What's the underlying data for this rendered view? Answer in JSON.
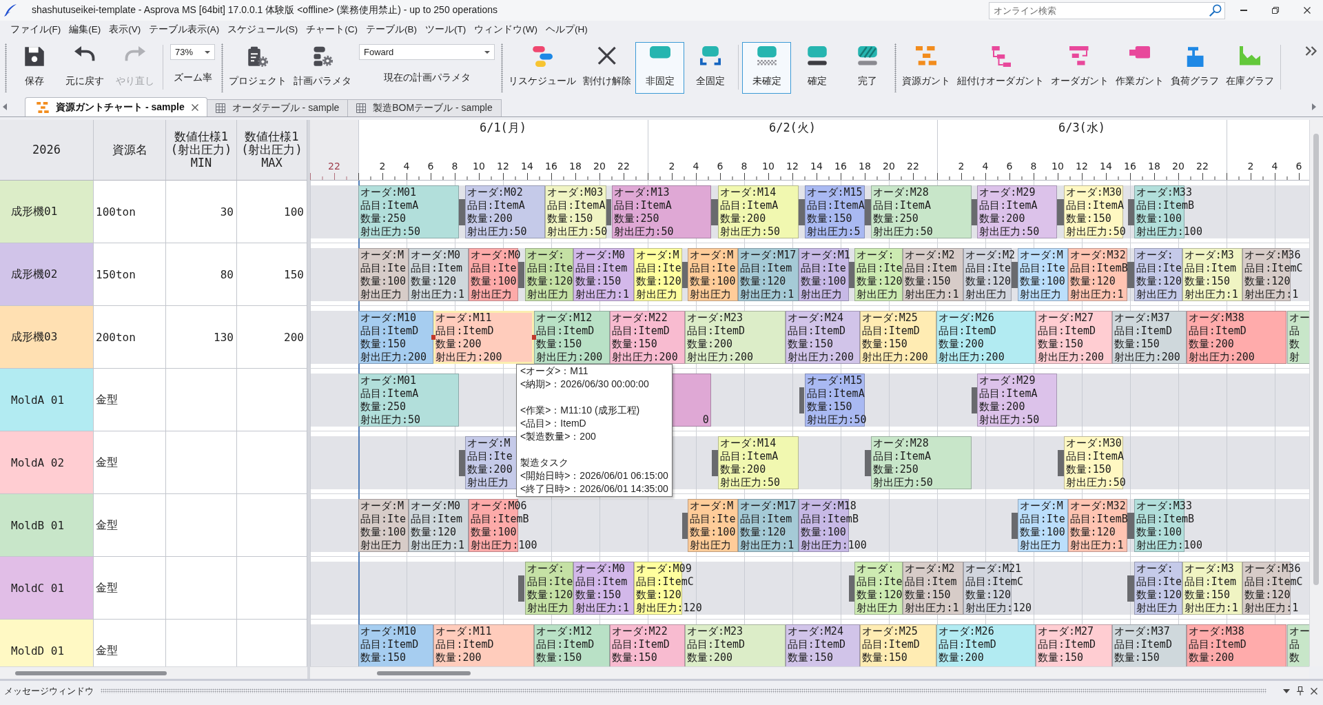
{
  "window": {
    "title": "shashutuseikei-template - Asprova MS [64bit] 17.0.0.1 体験版 <offline> (業務使用禁止) - up to 250 operations",
    "search": {
      "placeholder": "オンライン検索"
    }
  },
  "menu": [
    "ファイル(F)",
    "編集(E)",
    "表示(V)",
    "テーブル表示(A)",
    "スケジュール(S)",
    "チャート(C)",
    "テーブル(B)",
    "ツール(T)",
    "ウィンドウ(W)",
    "ヘルプ(H)"
  ],
  "toolbar": {
    "groups": [
      {
        "items": [
          {
            "kind": "button",
            "label": "保存",
            "selected": false,
            "disabled": false
          },
          {
            "kind": "button",
            "label": "元に戻す",
            "selected": false,
            "disabled": false
          },
          {
            "kind": "button",
            "label": "やり直し",
            "selected": false,
            "disabled": true
          },
          {
            "kind": "separator"
          },
          {
            "kind": "dropdown",
            "value": "73%",
            "caption": "ズーム率"
          }
        ]
      },
      {
        "items": [
          {
            "kind": "button",
            "label": "プロジェクト",
            "selected": false,
            "disabled": false
          },
          {
            "kind": "button",
            "label": "計画パラメタ",
            "selected": false,
            "disabled": false
          },
          {
            "kind": "dropdown",
            "value": "Foward",
            "caption": "現在の計画パラメタ"
          }
        ]
      },
      {
        "items": [
          {
            "kind": "button",
            "label": "リスケジュール",
            "selected": false,
            "disabled": false
          },
          {
            "kind": "button",
            "label": "割付け解除",
            "selected": false,
            "disabled": false
          },
          {
            "kind": "button",
            "label": "非固定",
            "selected": true,
            "disabled": false
          },
          {
            "kind": "button",
            "label": "全固定",
            "selected": false,
            "disabled": false
          },
          {
            "kind": "separator"
          },
          {
            "kind": "button",
            "label": "未確定",
            "selected": true,
            "disabled": false
          },
          {
            "kind": "button",
            "label": "確定",
            "selected": false,
            "disabled": false
          },
          {
            "kind": "button",
            "label": "完了",
            "selected": false,
            "disabled": false
          }
        ]
      },
      {
        "items": [
          {
            "kind": "button",
            "label": "資源ガント",
            "selected": false,
            "disabled": false
          },
          {
            "kind": "button",
            "label": "紐付けオーダガント",
            "selected": false,
            "disabled": false
          },
          {
            "kind": "button",
            "label": "オーダガント",
            "selected": false,
            "disabled": false
          },
          {
            "kind": "button",
            "label": "作業ガント",
            "selected": false,
            "disabled": false
          },
          {
            "kind": "button",
            "label": "負荷グラフ",
            "selected": false,
            "disabled": false
          },
          {
            "kind": "button",
            "label": "在庫グラフ",
            "selected": false,
            "disabled": false
          },
          {
            "kind": "separator"
          }
        ]
      }
    ]
  },
  "tabs": [
    {
      "label": "資源ガントチャート - sample",
      "selected": true
    },
    {
      "label": "オーダテーブル - sample",
      "selected": false
    },
    {
      "label": "製造BOMテーブル - sample",
      "selected": false
    }
  ],
  "table": {
    "columns": [
      "2026",
      "資源名",
      "数値仕様1\n(射出圧力)\nMIN",
      "数値仕様1\n(射出圧力)\nMAX"
    ]
  },
  "gantt": {
    "days": [
      {
        "holiday": true,
        "hours": [
          "22"
        ]
      },
      {
        "label": "6/1(月)",
        "holiday": false,
        "hours": [
          "2",
          "4",
          "6",
          "8",
          "10",
          "12",
          "14",
          "16",
          "18",
          "20",
          "22"
        ]
      },
      {
        "label": "6/2(火)",
        "holiday": false,
        "hours": [
          "2",
          "4",
          "6",
          "8",
          "10",
          "12",
          "14",
          "16",
          "18",
          "20",
          "22"
        ]
      },
      {
        "label": "6/3(水)",
        "holiday": false,
        "hours": [
          "2",
          "4",
          "6",
          "8",
          "10",
          "12",
          "14",
          "16",
          "18",
          "20",
          "22"
        ]
      },
      {
        "holiday": false,
        "hours": [
          "2",
          "4",
          "6"
        ]
      }
    ]
  },
  "resources": [
    {
      "name": "成形機01",
      "resource_name": "100ton",
      "min": "30",
      "max": "100",
      "color": "#dcedc8",
      "items": [
        {
          "kind": "task",
          "color": "#b2dfdb",
          "selected": false,
          "lines": [
            "オーダ:M01",
            "品目:ItemA",
            "数量:250",
            "射出圧力:50"
          ]
        },
        {
          "kind": "setup"
        },
        {
          "kind": "task",
          "color": "#c5cae9",
          "selected": false,
          "lines": [
            "オーダ:M02",
            "品目:ItemA",
            "数量:200",
            "射出圧力:50"
          ]
        },
        {
          "kind": "task",
          "color": "#f0f4c3",
          "selected": false,
          "lines": [
            "オーダ:M03",
            "品目:ItemA",
            "数量:150",
            "射出圧力:50"
          ]
        },
        {
          "kind": "setup"
        },
        {
          "kind": "task",
          "color": "#dfa8d5",
          "selected": false,
          "lines": [
            "オーダ:M13",
            "品目:ItemA",
            "数量:250",
            "射出圧力:50"
          ]
        },
        {
          "kind": "setup"
        },
        {
          "kind": "task",
          "color": "#f1f8b0",
          "selected": false,
          "lines": [
            "オーダ:M14",
            "品目:ItemA",
            "数量:200",
            "射出圧力:50"
          ]
        },
        {
          "kind": "setup"
        },
        {
          "kind": "task",
          "color": "#a9b9f2",
          "selected": false,
          "lines": [
            "オーダ:M15",
            "品目:ItemA",
            "数量:150",
            "射出圧力:5"
          ]
        },
        {
          "kind": "setup"
        },
        {
          "kind": "task",
          "color": "#c8e6c9",
          "selected": false,
          "lines": [
            "オーダ:M28",
            "品目:ItemA",
            "数量:250",
            "射出圧力:50"
          ]
        },
        {
          "kind": "setup"
        },
        {
          "kind": "task",
          "color": "#dcc2ea",
          "selected": false,
          "lines": [
            "オーダ:M29",
            "品目:ItemA",
            "数量:200",
            "射出圧力:50"
          ]
        },
        {
          "kind": "setup"
        },
        {
          "kind": "task",
          "color": "#fff8c2",
          "selected": false,
          "lines": [
            "オーダ:M30",
            "品目:ItemA",
            "数量:150",
            "射出圧力:50"
          ]
        },
        {
          "kind": "setup"
        },
        {
          "kind": "task",
          "color": "#b2dfdb",
          "selected": false,
          "lines": [
            "オーダ:M33",
            "品目:ItemB",
            "数量:100",
            "射出圧力:100"
          ]
        }
      ]
    },
    {
      "name": "成形機02",
      "resource_name": "150ton",
      "min": "80",
      "max": "150",
      "color": "#d1c4e9",
      "items": [
        {
          "kind": "task",
          "color": "#d7ccc8",
          "selected": false,
          "lines": [
            "オーダ:M",
            "品目:Ite",
            "数量:100",
            "射出圧力"
          ]
        },
        {
          "kind": "task",
          "color": "#cfd8dc",
          "selected": false,
          "lines": [
            "オーダ:M0",
            "品目:Item",
            "数量:120",
            "射出圧力:1"
          ]
        },
        {
          "kind": "task",
          "color": "#fdaaa9",
          "selected": false,
          "lines": [
            "オーダ:M0",
            "品目:Ite",
            "数量:100",
            "射出圧力"
          ]
        },
        {
          "kind": "setup"
        },
        {
          "kind": "task",
          "color": "#c5e1a5",
          "selected": false,
          "lines": [
            "オーダ:",
            "品目:Ite",
            "数量:120",
            "射出圧力"
          ]
        },
        {
          "kind": "task",
          "color": "#d3b8ea",
          "selected": false,
          "lines": [
            "オーダ:M0",
            "品目:Item",
            "数量:150",
            "射出圧力:1"
          ]
        },
        {
          "kind": "task",
          "color": "#ffff9e",
          "selected": false,
          "lines": [
            "オーダ:M",
            "品目:Ite",
            "数量:120",
            "射出圧力"
          ]
        },
        {
          "kind": "setup"
        },
        {
          "kind": "task",
          "color": "#ffcc99",
          "selected": false,
          "lines": [
            "オーダ:M",
            "品目:Ite",
            "数量:100",
            "射出圧力"
          ]
        },
        {
          "kind": "task",
          "color": "#a5cad6",
          "selected": false,
          "lines": [
            "オーダ:M17",
            "品目:Item",
            "数量:120",
            "射出圧力:1"
          ]
        },
        {
          "kind": "task",
          "color": "#c7b9e6",
          "selected": false,
          "lines": [
            "オーダ:M1",
            "品目:Ite",
            "数量:100",
            "射出圧力"
          ]
        },
        {
          "kind": "setup"
        },
        {
          "kind": "task",
          "color": "#cdebb2",
          "selected": false,
          "lines": [
            "オーダ:",
            "品目:Ite",
            "数量:120",
            "射出圧力"
          ]
        },
        {
          "kind": "task",
          "color": "#d7ccc8",
          "selected": false,
          "lines": [
            "オーダ:M2",
            "品目:Item",
            "数量:150",
            "射出圧力:1"
          ]
        },
        {
          "kind": "task",
          "color": "#d1d5de",
          "selected": false,
          "lines": [
            "オーダ:M2",
            "品目:Ite",
            "数量:120",
            "射出圧力"
          ]
        },
        {
          "kind": "setup"
        },
        {
          "kind": "task",
          "color": "#bbdefb",
          "selected": false,
          "lines": [
            "オーダ:M",
            "品目:Ite",
            "数量:100",
            "射出圧力"
          ]
        },
        {
          "kind": "task",
          "color": "#ffc4b2",
          "selected": false,
          "lines": [
            "オーダ:M32",
            "品目:ItemB",
            "数量:120",
            "射出圧力:1"
          ]
        },
        {
          "kind": "setup"
        },
        {
          "kind": "task",
          "color": "#c5cae9",
          "selected": false,
          "lines": [
            "オーダ:",
            "品目:Ite",
            "数量:120",
            "射出圧力"
          ]
        },
        {
          "kind": "task",
          "color": "#f0f4c3",
          "selected": false,
          "lines": [
            "オーダ:M3",
            "品目:Item",
            "数量:150",
            "射出圧力:1"
          ]
        },
        {
          "kind": "task",
          "color": "#d7ccc8",
          "selected": false,
          "lines": [
            "オーダ:M36",
            "品目:ItemC",
            "数量:120",
            "射出圧力:1"
          ]
        }
      ]
    },
    {
      "name": "成形機03",
      "resource_name": "200ton",
      "min": "130",
      "max": "200",
      "color": "#ffe0b2",
      "items": [
        {
          "kind": "task",
          "color": "#a6cdf0",
          "selected": false,
          "lines": [
            "オーダ:M10",
            "品目:ItemD",
            "数量:150",
            "射出圧力:200"
          ]
        },
        {
          "kind": "task",
          "color": "#ffccbc",
          "selected": true,
          "lines": [
            "オーダ:M11",
            "品目:ItemD",
            "数量:200",
            "射出圧力:200"
          ]
        },
        {
          "kind": "task",
          "color": "#b9e1c6",
          "selected": false,
          "lines": [
            "オーダ:M12",
            "品目:ItemD",
            "数量:150",
            "射出圧力:200"
          ]
        },
        {
          "kind": "task",
          "color": "#f8bbd0",
          "selected": false,
          "lines": [
            "オーダ:M22",
            "品目:ItemD",
            "数量:150",
            "射出圧力:200"
          ]
        },
        {
          "kind": "task",
          "color": "#dcedc8",
          "selected": false,
          "lines": [
            "オーダ:M23",
            "品目:ItemD",
            "数量:200",
            "射出圧力:200"
          ]
        },
        {
          "kind": "task",
          "color": "#d1c4e9",
          "selected": false,
          "lines": [
            "オーダ:M24",
            "品目:ItemD",
            "数量:150",
            "射出圧力:200"
          ]
        },
        {
          "kind": "task",
          "color": "#ffecb3",
          "selected": false,
          "lines": [
            "オーダ:M25",
            "品目:ItemD",
            "数量:150",
            "射出圧力:200"
          ]
        },
        {
          "kind": "task",
          "color": "#b2ebf2",
          "selected": false,
          "lines": [
            "オーダ:M26",
            "品目:ItemD",
            "数量:200",
            "射出圧力:200"
          ]
        },
        {
          "kind": "task",
          "color": "#ffcdd2",
          "selected": false,
          "lines": [
            "オーダ:M27",
            "品目:ItemD",
            "数量:150",
            "射出圧力:200"
          ]
        },
        {
          "kind": "task",
          "color": "#cfd8dc",
          "selected": false,
          "lines": [
            "オーダ:M37",
            "品目:ItemD",
            "数量:150",
            "射出圧力:200"
          ]
        },
        {
          "kind": "task",
          "color": "#ffabab",
          "selected": false,
          "lines": [
            "オーダ:M38",
            "品目:ItemD",
            "数量:200",
            "射出圧力:200"
          ]
        },
        {
          "kind": "task",
          "color": "#c8e6c9",
          "selected": false,
          "lines": [
            "オー",
            "品",
            "数",
            "射"
          ]
        }
      ]
    },
    {
      "name": "MoldA 01",
      "resource_name": "金型",
      "color": "#b2ebf2",
      "items": [
        {
          "kind": "task",
          "color": "#b2dfdb",
          "selected": false,
          "lines": [
            "オーダ:M01",
            "品目:ItemA",
            "数量:250",
            "射出圧力:50"
          ]
        },
        {
          "kind": "covered_task",
          "color": "#dfa8d5",
          "selected": false,
          "lines": [
            "0"
          ]
        },
        {
          "kind": "setup"
        },
        {
          "kind": "task",
          "color": "#a9b9f2",
          "selected": false,
          "lines": [
            "オーダ:M15",
            "品目:ItemA",
            "数量:150",
            "射出圧力:50"
          ]
        },
        {
          "kind": "setup"
        },
        {
          "kind": "task",
          "color": "#dcc2ea",
          "selected": false,
          "lines": [
            "オーダ:M29",
            "品目:ItemA",
            "数量:200",
            "射出圧力:50"
          ]
        }
      ]
    },
    {
      "name": "MoldA 02",
      "resource_name": "金型",
      "color": "#ffcdd2",
      "items": [
        {
          "kind": "setup"
        },
        {
          "kind": "task",
          "color": "#c5cae9",
          "selected": false,
          "lines": [
            "オーダ:M",
            "品目:Ite",
            "数量:200",
            "射出圧力"
          ]
        },
        {
          "kind": "setup"
        },
        {
          "kind": "task",
          "color": "#f1f8b0",
          "selected": false,
          "lines": [
            "オーダ:M14",
            "品目:ItemA",
            "数量:200",
            "射出圧力:50"
          ]
        },
        {
          "kind": "setup"
        },
        {
          "kind": "task",
          "color": "#c8e6c9",
          "selected": false,
          "lines": [
            "オーダ:M28",
            "品目:ItemA",
            "数量:250",
            "射出圧力:50"
          ]
        },
        {
          "kind": "setup"
        },
        {
          "kind": "task",
          "color": "#fff8c2",
          "selected": false,
          "lines": [
            "オーダ:M30",
            "品目:ItemA",
            "数量:150",
            "射出圧力:50"
          ]
        }
      ]
    },
    {
      "name": "MoldB 01",
      "resource_name": "金型",
      "color": "#c8e6c9",
      "items": [
        {
          "kind": "task",
          "color": "#d7ccc8",
          "selected": false,
          "lines": [
            "オーダ:M",
            "品目:Ite",
            "数量:100",
            "射出圧力"
          ]
        },
        {
          "kind": "task",
          "color": "#cfd8dc",
          "selected": false,
          "lines": [
            "オーダ:M0",
            "品目:Item",
            "数量:120",
            "射出圧力:1"
          ]
        },
        {
          "kind": "task",
          "color": "#fdaaa9",
          "selected": false,
          "lines": [
            "オーダ:M06",
            "品目:ItemB",
            "数量:100",
            "射出圧力:100"
          ]
        },
        {
          "kind": "setup"
        },
        {
          "kind": "task",
          "color": "#ffcc99",
          "selected": false,
          "lines": [
            "オーダ:M",
            "品目:Ite",
            "数量:100",
            "射出圧力"
          ]
        },
        {
          "kind": "task",
          "color": "#a5cad6",
          "selected": false,
          "lines": [
            "オーダ:M17",
            "品目:Item",
            "数量:120",
            "射出圧力:1"
          ]
        },
        {
          "kind": "task",
          "color": "#c7b9e6",
          "selected": false,
          "lines": [
            "オーダ:M18",
            "品目:ItemB",
            "数量:100",
            "射出圧力:100"
          ]
        },
        {
          "kind": "setup"
        },
        {
          "kind": "task",
          "color": "#bbdefb",
          "selected": false,
          "lines": [
            "オーダ:M",
            "品目:Ite",
            "数量:100",
            "射出圧力"
          ]
        },
        {
          "kind": "task",
          "color": "#ffc4b2",
          "selected": false,
          "lines": [
            "オーダ:M32",
            "品目:ItemB",
            "数量:120",
            "射出圧力:1"
          ]
        },
        {
          "kind": "setup"
        },
        {
          "kind": "task",
          "color": "#b2dfdb",
          "selected": false,
          "lines": [
            "オーダ:M33",
            "品目:ItemB",
            "数量:100",
            "射出圧力:100"
          ]
        }
      ]
    },
    {
      "name": "MoldC 01",
      "resource_name": "金型",
      "color": "#e1bee7",
      "items": [
        {
          "kind": "setup"
        },
        {
          "kind": "task",
          "color": "#c5e1a5",
          "selected": false,
          "lines": [
            "オーダ:",
            "品目:Ite",
            "数量:120",
            "射出圧力"
          ]
        },
        {
          "kind": "task",
          "color": "#d3b8ea",
          "selected": false,
          "lines": [
            "オーダ:M0",
            "品目:Item",
            "数量:150",
            "射出圧力:1"
          ]
        },
        {
          "kind": "task",
          "color": "#ffff9e",
          "selected": false,
          "lines": [
            "オーダ:M09",
            "品目:ItemC",
            "数量:120",
            "射出圧力:120"
          ]
        },
        {
          "kind": "setup"
        },
        {
          "kind": "task",
          "color": "#cdebb2",
          "selected": false,
          "lines": [
            "オーダ:",
            "品目:Ite",
            "数量:120",
            "射出圧力"
          ]
        },
        {
          "kind": "task",
          "color": "#d7ccc8",
          "selected": false,
          "lines": [
            "オーダ:M2",
            "品目:Item",
            "数量:150",
            "射出圧力:1"
          ]
        },
        {
          "kind": "task",
          "color": "#d1d5de",
          "selected": false,
          "lines": [
            "オーダ:M21",
            "品目:ItemC",
            "数量:120",
            "射出圧力:120"
          ]
        },
        {
          "kind": "setup"
        },
        {
          "kind": "task",
          "color": "#c5cae9",
          "selected": false,
          "lines": [
            "オーダ:",
            "品目:Ite",
            "数量:120",
            "射出圧力"
          ]
        },
        {
          "kind": "task",
          "color": "#f0f4c3",
          "selected": false,
          "lines": [
            "オーダ:M3",
            "品目:Item",
            "数量:150",
            "射出圧力:1"
          ]
        },
        {
          "kind": "task",
          "color": "#d7ccc8",
          "selected": false,
          "lines": [
            "オーダ:M36",
            "品目:ItemC",
            "数量:120",
            "射出圧力:1"
          ]
        }
      ]
    },
    {
      "name": "MoldD 01",
      "resource_name": "金型",
      "color": "#fff9c4",
      "items": [
        {
          "kind": "task",
          "color": "#a6cdf0",
          "selected": false,
          "lines": [
            "オーダ:M10",
            "品目:ItemD",
            "数量:150"
          ]
        },
        {
          "kind": "task",
          "color": "#ffccbc",
          "selected": false,
          "lines": [
            "オーダ:M11",
            "品目:ItemD",
            "数量:200"
          ]
        },
        {
          "kind": "task",
          "color": "#b9e1c6",
          "selected": false,
          "lines": [
            "オーダ:M12",
            "品目:ItemD",
            "数量:150"
          ]
        },
        {
          "kind": "task",
          "color": "#f8bbd0",
          "selected": false,
          "lines": [
            "オーダ:M22",
            "品目:ItemD",
            "数量:150"
          ]
        },
        {
          "kind": "task",
          "color": "#dcedc8",
          "selected": false,
          "lines": [
            "オーダ:M23",
            "品目:ItemD",
            "数量:200"
          ]
        },
        {
          "kind": "task",
          "color": "#d1c4e9",
          "selected": false,
          "lines": [
            "オーダ:M24",
            "品目:ItemD",
            "数量:150"
          ]
        },
        {
          "kind": "task",
          "color": "#ffecb3",
          "selected": false,
          "lines": [
            "オーダ:M25",
            "品目:ItemD",
            "数量:150"
          ]
        },
        {
          "kind": "task",
          "color": "#b2ebf2",
          "selected": false,
          "lines": [
            "オーダ:M26",
            "品目:ItemD",
            "数量:200"
          ]
        },
        {
          "kind": "task",
          "color": "#ffcdd2",
          "selected": false,
          "lines": [
            "オーダ:M27",
            "品目:ItemD",
            "数量:150"
          ]
        },
        {
          "kind": "task",
          "color": "#cfd8dc",
          "selected": false,
          "lines": [
            "オーダ:M37",
            "品目:ItemD",
            "数量:150"
          ]
        },
        {
          "kind": "task",
          "color": "#ffabab",
          "selected": false,
          "lines": [
            "オーダ:M38",
            "品目:ItemD",
            "数量:200"
          ]
        },
        {
          "kind": "task",
          "color": "#c8e6c9",
          "selected": false,
          "lines": [
            "オー",
            "品",
            "数"
          ]
        }
      ]
    }
  ],
  "tooltip": {
    "sections": [
      [
        "<オーダ>：M11",
        "<納期>：2026/06/30 00:00:00"
      ],
      [
        "<作業>：M11:10 (成形工程)",
        "<品目>：ItemD",
        "<製造数量>：200"
      ],
      [
        "製造タスク",
        "<開始日時>：2026/06/01 06:15:00",
        "<終了日時>：2026/06/01 14:35:00"
      ]
    ]
  },
  "message_window": {
    "title": "メッセージウィンドウ"
  }
}
